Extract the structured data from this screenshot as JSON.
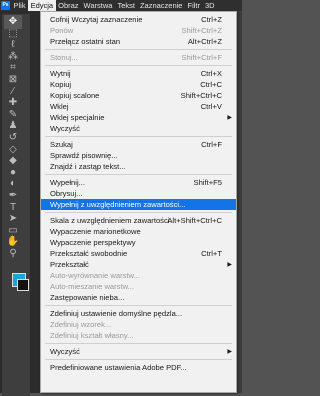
{
  "menubar": {
    "logo": "Ps",
    "items": [
      {
        "label": "Plik"
      },
      {
        "label": "Edycja",
        "active": true
      },
      {
        "label": "Obraz"
      },
      {
        "label": "Warstwa"
      },
      {
        "label": "Tekst"
      },
      {
        "label": "Zaznaczenie"
      },
      {
        "label": "Filtr"
      },
      {
        "label": "3D"
      }
    ]
  },
  "toolbar": {
    "tools": [
      {
        "name": "move-tool-icon",
        "glyph": "✥"
      },
      {
        "name": "marquee-tool-icon",
        "glyph": "⬚"
      },
      {
        "name": "lasso-tool-icon",
        "glyph": "ℓ"
      },
      {
        "name": "magic-wand-tool-icon",
        "glyph": "⁂"
      },
      {
        "name": "crop-tool-icon",
        "glyph": "⌗"
      },
      {
        "name": "frame-tool-icon",
        "glyph": "⊠"
      },
      {
        "name": "eyedropper-tool-icon",
        "glyph": "⁄"
      },
      {
        "name": "healing-brush-tool-icon",
        "glyph": "✚"
      },
      {
        "name": "brush-tool-icon",
        "glyph": "✎"
      },
      {
        "name": "clone-stamp-tool-icon",
        "glyph": "♟"
      },
      {
        "name": "history-brush-tool-icon",
        "glyph": "↺"
      },
      {
        "name": "eraser-tool-icon",
        "glyph": "◇"
      },
      {
        "name": "paint-bucket-tool-icon",
        "glyph": "◆"
      },
      {
        "name": "blur-tool-icon",
        "glyph": "●"
      },
      {
        "name": "dodge-tool-icon",
        "glyph": "◐"
      },
      {
        "name": "pen-tool-icon",
        "glyph": "✒"
      },
      {
        "name": "type-tool-icon",
        "glyph": "T"
      },
      {
        "name": "path-selection-tool-icon",
        "glyph": "➤"
      },
      {
        "name": "rectangle-tool-icon",
        "glyph": "▭"
      },
      {
        "name": "hand-tool-icon",
        "glyph": "✋"
      },
      {
        "name": "zoom-tool-icon",
        "glyph": "⚲"
      }
    ],
    "foreground_color": "#1fa2d8",
    "background_color": "#111111"
  },
  "menu": {
    "items": [
      {
        "label": "Cofnij Wczytaj zaznaczenie",
        "shortcut": "Ctrl+Z"
      },
      {
        "label": "Ponów",
        "shortcut": "Shift+Ctrl+Z",
        "disabled": true
      },
      {
        "label": "Przełącz ostatni stan",
        "shortcut": "Alt+Ctrl+Z"
      },
      {
        "sep": true
      },
      {
        "label": "Stonuj...",
        "shortcut": "Shift+Ctrl+F",
        "disabled": true
      },
      {
        "sep": true
      },
      {
        "label": "Wytnij",
        "shortcut": "Ctrl+X"
      },
      {
        "label": "Kopiuj",
        "shortcut": "Ctrl+C"
      },
      {
        "label": "Kopiuj scalone",
        "shortcut": "Shift+Ctrl+C"
      },
      {
        "label": "Wklej",
        "shortcut": "Ctrl+V"
      },
      {
        "label": "Wklej specjalnie",
        "submenu": true
      },
      {
        "label": "Wyczyść"
      },
      {
        "sep": true
      },
      {
        "label": "Szukaj",
        "shortcut": "Ctrl+F"
      },
      {
        "label": "Sprawdź pisownię..."
      },
      {
        "label": "Znajdź i zastąp tekst..."
      },
      {
        "sep": true
      },
      {
        "label": "Wypełnij...",
        "shortcut": "Shift+F5"
      },
      {
        "label": "Obrysuj..."
      },
      {
        "label": "Wypełnij z uwzględnieniem zawartości...",
        "highlighted": true
      },
      {
        "sep": true
      },
      {
        "label": "Skala z uwzględnieniem zawartości",
        "shortcut": "Alt+Shift+Ctrl+C"
      },
      {
        "label": "Wypaczenie marionetkowe"
      },
      {
        "label": "Wypaczenie perspektywy"
      },
      {
        "label": "Przekształć swobodnie",
        "shortcut": "Ctrl+T"
      },
      {
        "label": "Przekształć",
        "submenu": true
      },
      {
        "label": "Auto-wyrównanie warstw...",
        "disabled": true
      },
      {
        "label": "Auto-mieszanie warstw...",
        "disabled": true
      },
      {
        "label": "Zastępowanie nieba..."
      },
      {
        "sep": true
      },
      {
        "label": "Zdefiniuj ustawienie domyślne pędzla..."
      },
      {
        "label": "Zdefiniuj wzorek...",
        "disabled": true
      },
      {
        "label": "Zdefiniuj kształt własny...",
        "disabled": true
      },
      {
        "sep": true
      },
      {
        "label": "Wyczyść",
        "submenu": true
      },
      {
        "sep": true
      },
      {
        "label": "Predefiniowane ustawienia Adobe PDF..."
      }
    ]
  }
}
